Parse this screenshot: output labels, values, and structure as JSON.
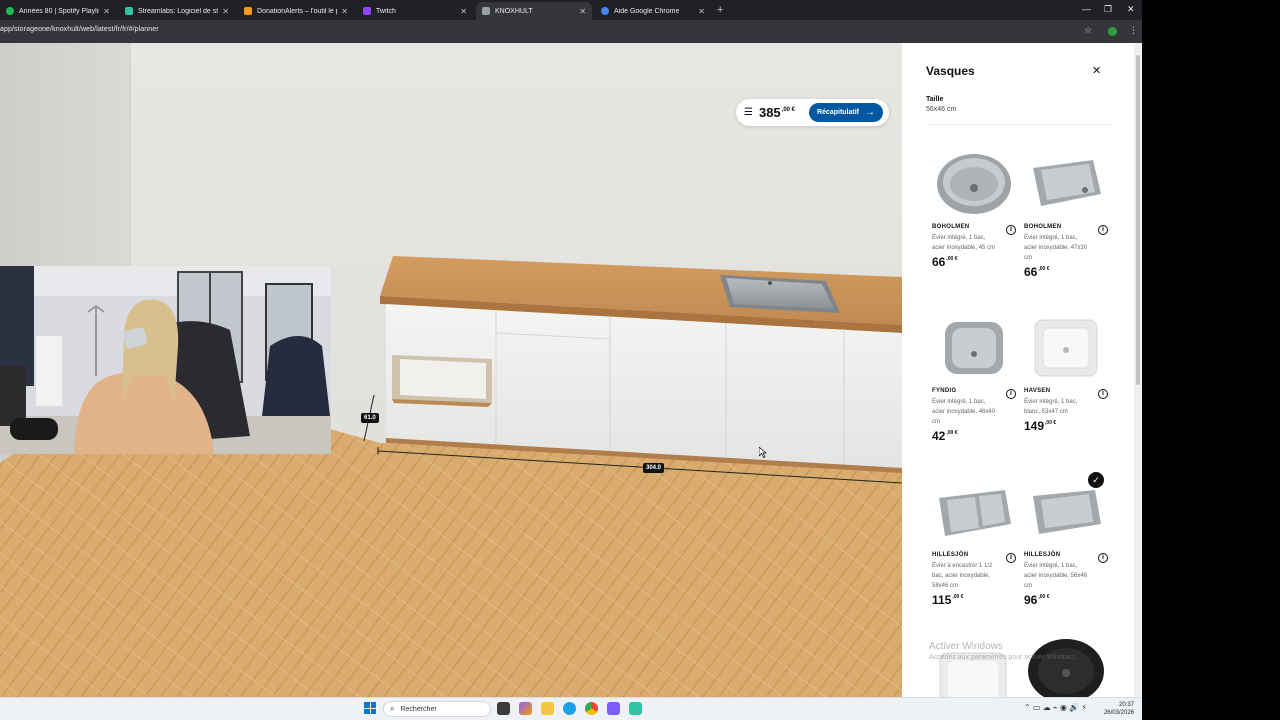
{
  "browser": {
    "tabs": [
      {
        "title": "Années 80 | Spotify Playlist",
        "fav_color": "#1db954",
        "active": false
      },
      {
        "title": "Streamlabs: Logiciel de stream",
        "fav_color": "#31c3a2",
        "active": false
      },
      {
        "title": "DonationAlerts – l'outil le plus",
        "fav_color": "#f59c1a",
        "active": false
      },
      {
        "title": "Twitch",
        "fav_color": "#9146ff",
        "active": false
      },
      {
        "title": "KNOXHULT",
        "fav_color": "#9aa0a6",
        "active": true
      },
      {
        "title": "Aide Google Chrome",
        "fav_color": "#4285f4",
        "active": false
      }
    ],
    "url": "app/storageone/knoxhult/web/latest/fr/fr/#/planner"
  },
  "planner": {
    "summary": {
      "price_main": "385",
      "price_cents": ",00 €",
      "button_label": "Récapitulatif"
    },
    "dimensions": {
      "height": "61.0",
      "width": "304.0"
    }
  },
  "panel": {
    "title": "Vasques",
    "size_label": "Taille",
    "size_value": "56x46 cm",
    "products": [
      {
        "name": "BOHOLMEN",
        "desc": "Évier intégré, 1 bac, acier inoxydable, 45 cm",
        "price": "66",
        "cents": ",00 €",
        "icon": "round-sink"
      },
      {
        "name": "BOHOLMEN",
        "desc": "Évier intégré, 1 bac, acier inoxydable, 47x30 cm",
        "price": "66",
        "cents": ",00 €",
        "icon": "rect-sink"
      },
      {
        "name": "FYNDIG",
        "desc": "Évier intégré, 1 bac, acier inoxydable, 46x40 cm",
        "price": "42",
        "cents": ",00 €",
        "icon": "square-sink"
      },
      {
        "name": "HAVSEN",
        "desc": "Évier intégré, 1 bac, blanc, 53x47 cm",
        "price": "149",
        "cents": ",00 €",
        "icon": "ceramic-sink"
      },
      {
        "name": "HILLESJÖN",
        "desc": "Évier à encastrer 1 1/2 bac, acier inoxydable, 58x46 cm",
        "price": "115",
        "cents": ",00 €",
        "icon": "double-sink"
      },
      {
        "name": "HILLESJÖN",
        "desc": "Évier intégré, 1 bac, acier inoxydable, 56x46 cm",
        "price": "96",
        "cents": ",00 €",
        "icon": "rect-sink",
        "selected": true
      }
    ],
    "watermark_title": "Activer Windows",
    "watermark_sub": "Accédez aux paramètres pour activer Windows."
  },
  "taskbar": {
    "search_placeholder": "Rechercher",
    "time": "20:37",
    "date": "26/03/2026"
  },
  "colors": {
    "accent": "#0058a3",
    "floor": "#d7a86a",
    "countertop": "#c8925a"
  }
}
